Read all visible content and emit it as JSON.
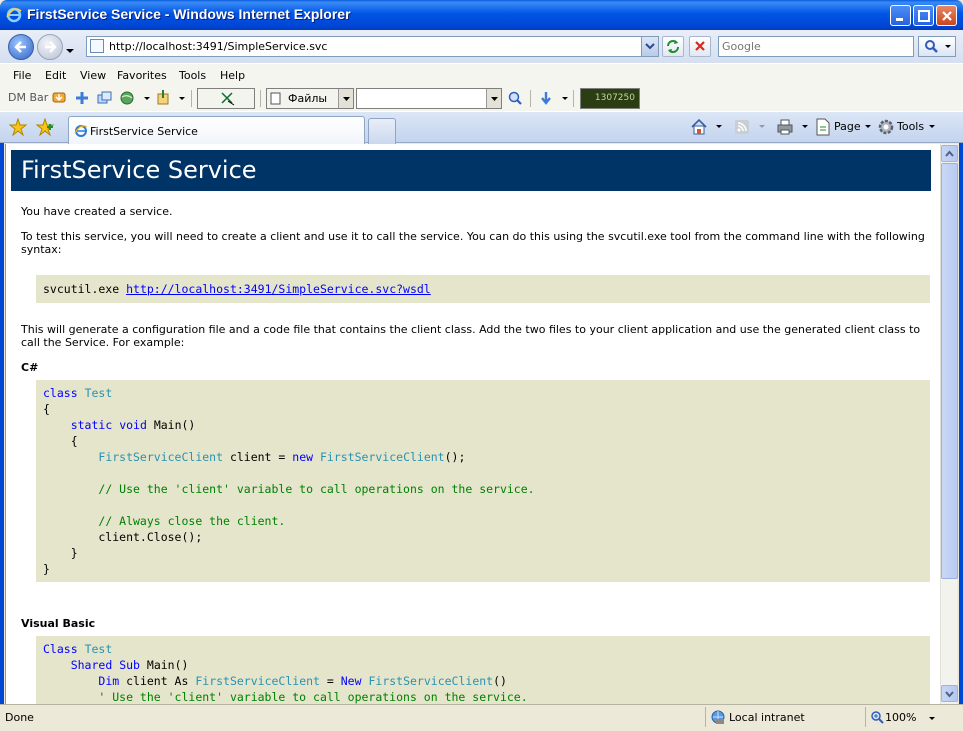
{
  "window": {
    "title": "FirstService Service - Windows Internet Explorer"
  },
  "address_bar": {
    "url": "http://localhost:3491/SimpleService.svc",
    "search_placeholder": "Google"
  },
  "menu": {
    "items": [
      "File",
      "Edit",
      "View",
      "Favorites",
      "Tools",
      "Help"
    ]
  },
  "dm_bar": {
    "label": "DM Bar",
    "folder_value": "Файлы",
    "speed_readout": "1307250"
  },
  "tabs": {
    "active_title": "FirstService Service"
  },
  "command_bar": {
    "page_label": "Page",
    "tools_label": "Tools"
  },
  "content": {
    "heading": "FirstService Service",
    "intro": "You have created a service.",
    "instructions": "To test this service, you will need to create a client and use it to call the service. You can do this using the svcutil.exe tool from the command line with the following syntax:",
    "svcutil_command": "svcutil.exe ",
    "wsdl_link": "http://localhost:3491/SimpleService.svc?wsdl",
    "generate_text": "This will generate a configuration file and a code file that contains the client class. Add the two files to your client application and use the generated client class to call the Service. For example:",
    "csharp_label": "C#",
    "vb_label": "Visual Basic"
  },
  "status_bar": {
    "status": "Done",
    "zone": "Local intranet",
    "zoom": "100%"
  },
  "colors": {
    "heading_bg": "#003366",
    "code_bg": "#E5E5CC",
    "keyword": "#0000FF",
    "type": "#2B91AF",
    "comment": "#008000"
  }
}
